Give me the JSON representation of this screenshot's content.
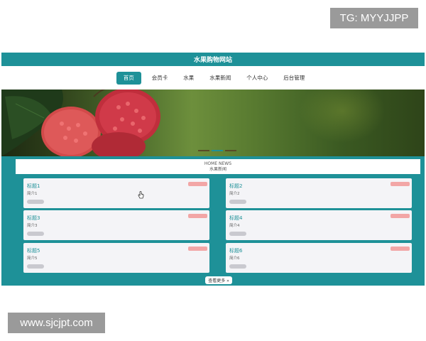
{
  "watermarks": {
    "top_right": "TG: MYYJJPP",
    "bottom_left": "www.sjcjpt.com"
  },
  "site": {
    "title": "水果购物网站",
    "nav": [
      {
        "label": "首页",
        "active": true
      },
      {
        "label": "会员卡",
        "active": false
      },
      {
        "label": "水果",
        "active": false
      },
      {
        "label": "水果新闻",
        "active": false
      },
      {
        "label": "个人中心",
        "active": false
      },
      {
        "label": "后台管理",
        "active": false
      }
    ],
    "banner": {
      "icon": "raspberry-photo",
      "slides": 3,
      "active_slide": 2
    }
  },
  "news": {
    "heading_en": "HOME NEWS",
    "heading_cn": "水果新闻",
    "cards": [
      {
        "title": "标题1",
        "desc": "简介1"
      },
      {
        "title": "标题2",
        "desc": "简介2"
      },
      {
        "title": "标题3",
        "desc": "简介3"
      },
      {
        "title": "标题4",
        "desc": "简介4"
      },
      {
        "title": "标题5",
        "desc": "简介5"
      },
      {
        "title": "标题6",
        "desc": "简介6"
      }
    ],
    "more_label": "查看更多 »"
  },
  "colors": {
    "accent": "#1e9198",
    "badge": "#f2a6a6",
    "card_bg": "#f4f4f7",
    "watermark_bg": "#9a9a9a"
  }
}
